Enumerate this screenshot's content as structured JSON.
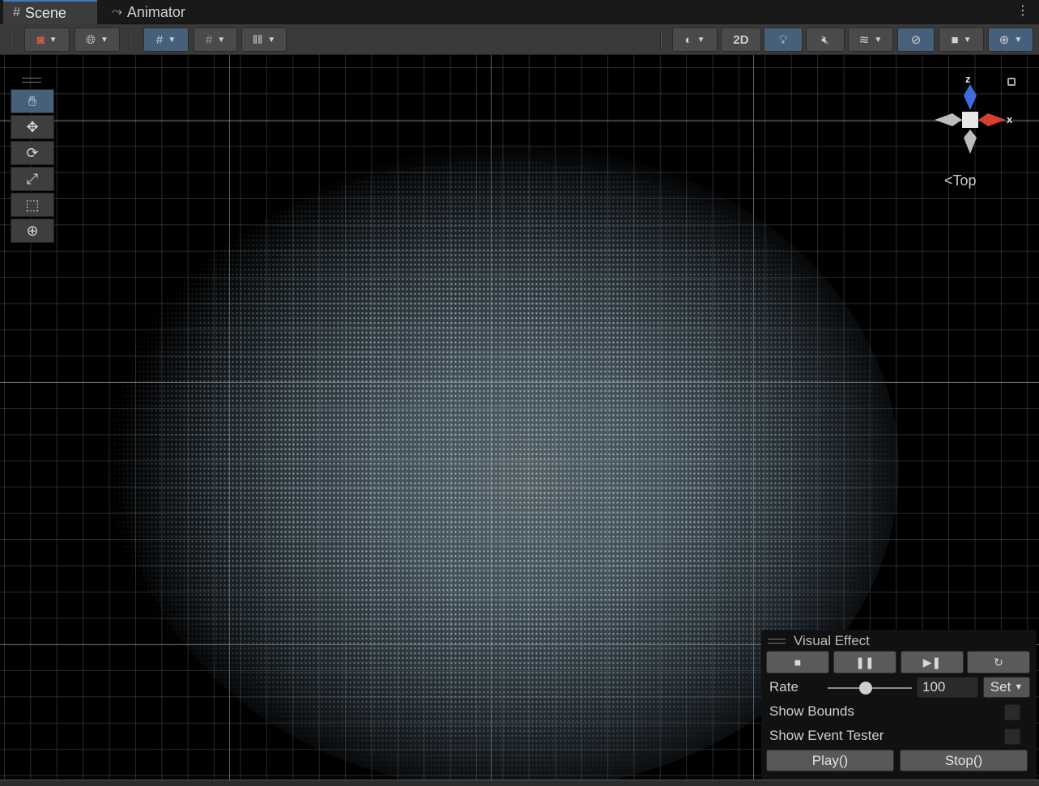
{
  "tabs": [
    {
      "label": "Scene",
      "icon": "hash-icon",
      "active": true
    },
    {
      "label": "Animator",
      "icon": "animator-icon",
      "active": false
    }
  ],
  "toolbar": {
    "two_d_label": "2D"
  },
  "tools": [
    {
      "name": "hand-tool",
      "glyph": "✋"
    },
    {
      "name": "move-tool",
      "glyph": "✥"
    },
    {
      "name": "rotate-tool",
      "glyph": "⟳"
    },
    {
      "name": "scale-tool",
      "glyph": "⤢"
    },
    {
      "name": "rect-tool",
      "glyph": "⬚"
    },
    {
      "name": "transform-tool",
      "glyph": "⊕"
    }
  ],
  "gizmo": {
    "z_label": "z",
    "x_label": "x",
    "view_label": "Top",
    "colors": {
      "z": "#3f6de0",
      "x": "#d6412f",
      "neutral": "#c8c8c8"
    }
  },
  "vfx": {
    "title": "Visual Effect",
    "rate_label": "Rate",
    "rate_value": "100",
    "rate_fraction": 0.45,
    "set_label": "Set",
    "show_bounds_label": "Show Bounds",
    "show_event_tester_label": "Show Event Tester",
    "play_label": "Play()",
    "stop_label": "Stop()"
  },
  "colors": {
    "accent": "#3a79bb",
    "active_button": "#46607c",
    "background": "#000000"
  }
}
